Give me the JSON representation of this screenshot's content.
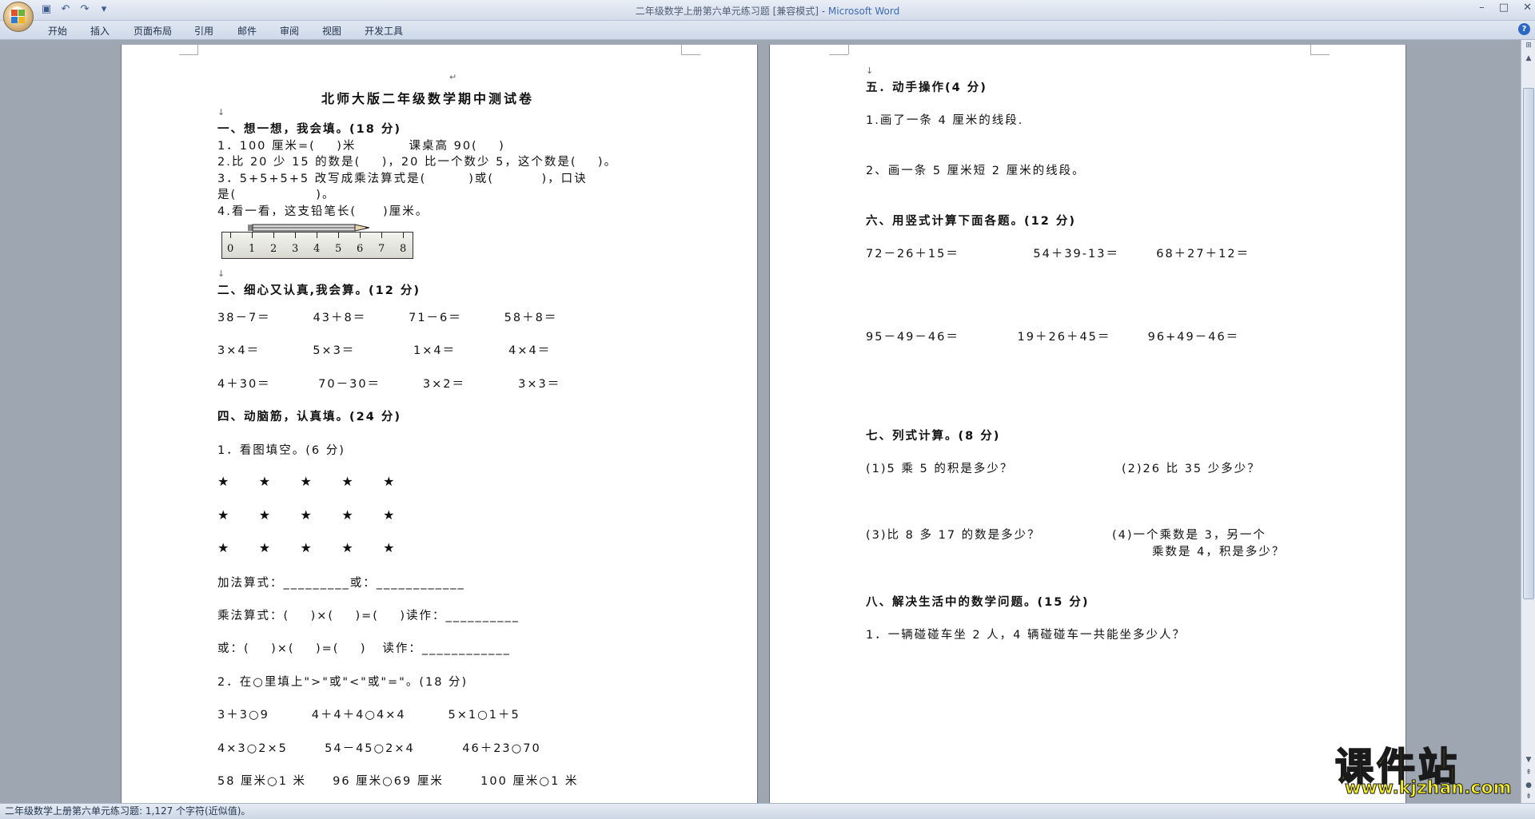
{
  "window": {
    "title_doc": "二年级数学上册第六单元练习题 [兼容模式] - ",
    "title_app": "Microsoft Word",
    "controls": [
      "–",
      "□",
      "✕"
    ]
  },
  "ribbon": {
    "tabs": [
      "开始",
      "插入",
      "页面布局",
      "引用",
      "邮件",
      "审阅",
      "视图",
      "开发工具"
    ],
    "help": "?"
  },
  "status_bar": {
    "text": "二年级数学上册第六单元练习题: 1,127 个字符(近似值)。"
  },
  "page1": {
    "title": "北师大版二年级数学期中测试卷",
    "s1_head": "一、想一想，我会填。(18 分)",
    "s1_q1": "1．100 厘米=(    )米          课桌高 90(    )",
    "s1_q2": "2.比 20 少 15 的数是(    )，20 比一个数少 5，这个数是(    )。",
    "s1_q3a": "3．5+5+5+5 改写成乘法算式是(        )或(         )，口诀",
    "s1_q3b": "是(               )。",
    "s1_q4": "4.看一看，这支铅笔长(     )厘米。",
    "ruler_numbers": [
      "0",
      "1",
      "2",
      "3",
      "4",
      "5",
      "6",
      "7",
      "8"
    ],
    "s2_head": "二、细心又认真,我会算。(12 分)",
    "s2_r1": "38－7＝        43＋8＝        71－6＝        58＋8＝",
    "s2_r2": "3×4＝          5×3＝           1×4＝          4×4＝",
    "s2_r3": "4＋30＝         70－30＝        3×2＝          3×3＝",
    "s4_head": "四、动脑筋，认真填。(24 分)",
    "s4_q1": "1．看图填空。(6 分)",
    "stars": "★     ★     ★     ★     ★",
    "s4_add": "加法算式：_________或：____________",
    "s4_mul": "乘法算式：(    )×(    )=(    )读作：__________",
    "s4_or": "或：(    )×(    )=(    )   读作：____________",
    "s4_q2": "2．在○里填上\">\"或\"<\"或\"=\"。(18 分)",
    "s4_r1": "3＋3○9        4＋4＋4○4×4        5×1○1＋5",
    "s4_r2": "4×3○2×5       54－45○2×4         46＋23○70",
    "s4_r3": "58 厘米○1 米     96 厘米○69 厘米       100 厘米○1 米"
  },
  "page2": {
    "s5_head": "五．动手操作(4 分)",
    "s5_q1": "1.画了一条 4 厘米的线段.",
    "s5_q2": "2、画一条 5 厘米短 2 厘米的线段。",
    "s6_head": "六、用竖式计算下面各题。(12 分)",
    "s6_r1": "72－26＋15＝              54＋39-13＝       68＋27＋12＝",
    "s6_r2": "95－49－46＝           19＋26＋45＝       96+49－46＝",
    "s7_head": "七、列式计算。(8 分)",
    "s7_q1": "(1)5 乘 5 的积是多少？",
    "s7_q2": "(2)26 比 35 少多少？",
    "s7_q3": "(3)比 8 多 17 的数是多少？",
    "s7_q4a": "(4)一个乘数是 3，另一个",
    "s7_q4b": "乘数是 4，积是多少？",
    "s8_head": "八、解决生活中的数学问题。(15 分)",
    "s8_q1": "1．一辆碰碰车坐 2 人，4 辆碰碰车一共能坐多少人？"
  },
  "marks": {
    "para": "↵",
    "line": "↓"
  },
  "watermark": {
    "cn": "课件站",
    "url": "www.kjzhan.com"
  }
}
